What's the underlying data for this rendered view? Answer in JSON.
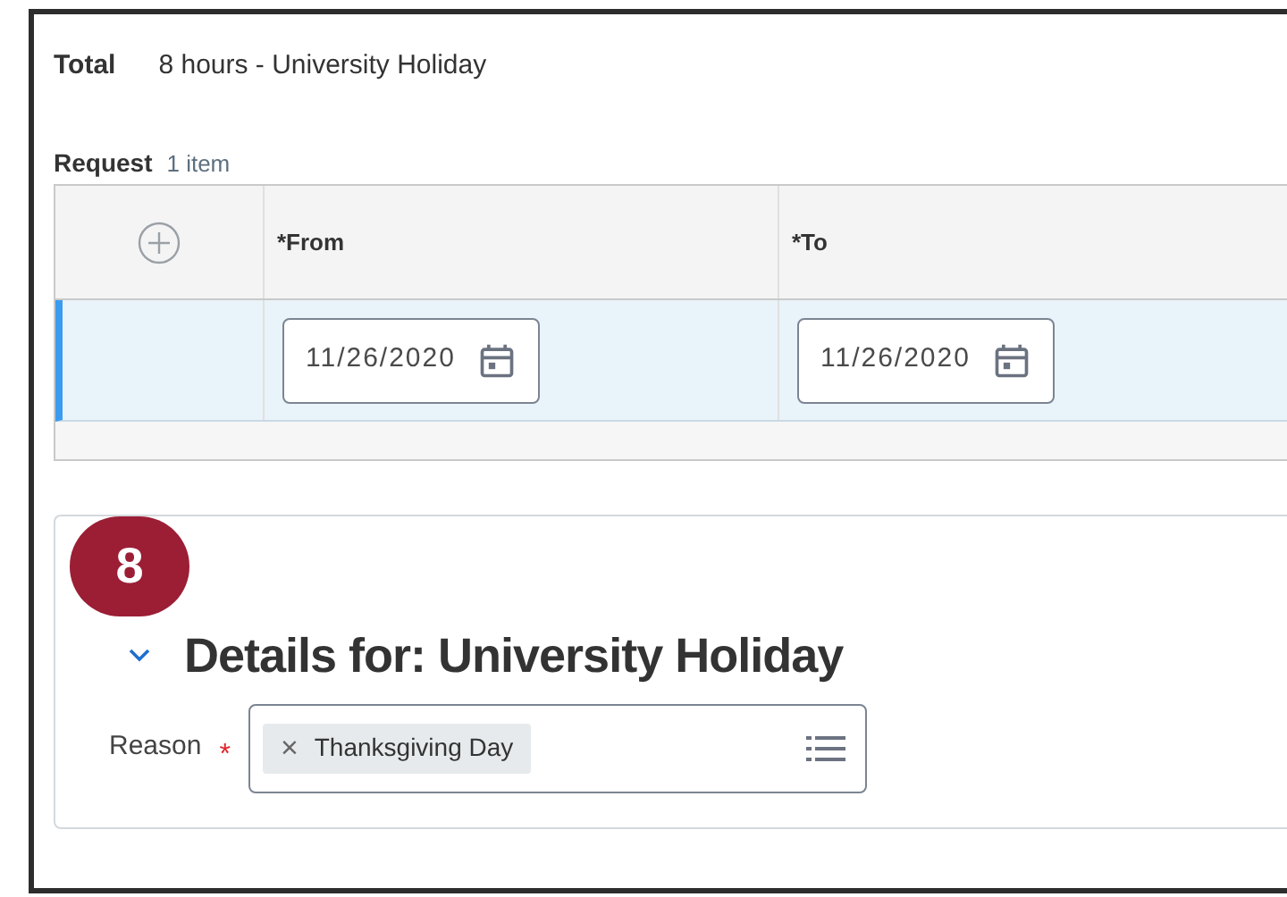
{
  "total": {
    "label": "Total",
    "value": "8 hours - University Holiday"
  },
  "request": {
    "label": "Request",
    "count": "1 item",
    "columns": [
      "*From",
      "*To"
    ],
    "rows": [
      {
        "selected": true,
        "from": "11/26/2020",
        "to": "11/26/2020"
      }
    ]
  },
  "step_badge": "8",
  "details": {
    "title": "Details for: University Holiday",
    "expanded": true,
    "reason": {
      "label": "Reason",
      "required_mark": "*",
      "tags": [
        {
          "label": "Thanksgiving Day",
          "remove": "×"
        }
      ]
    }
  }
}
